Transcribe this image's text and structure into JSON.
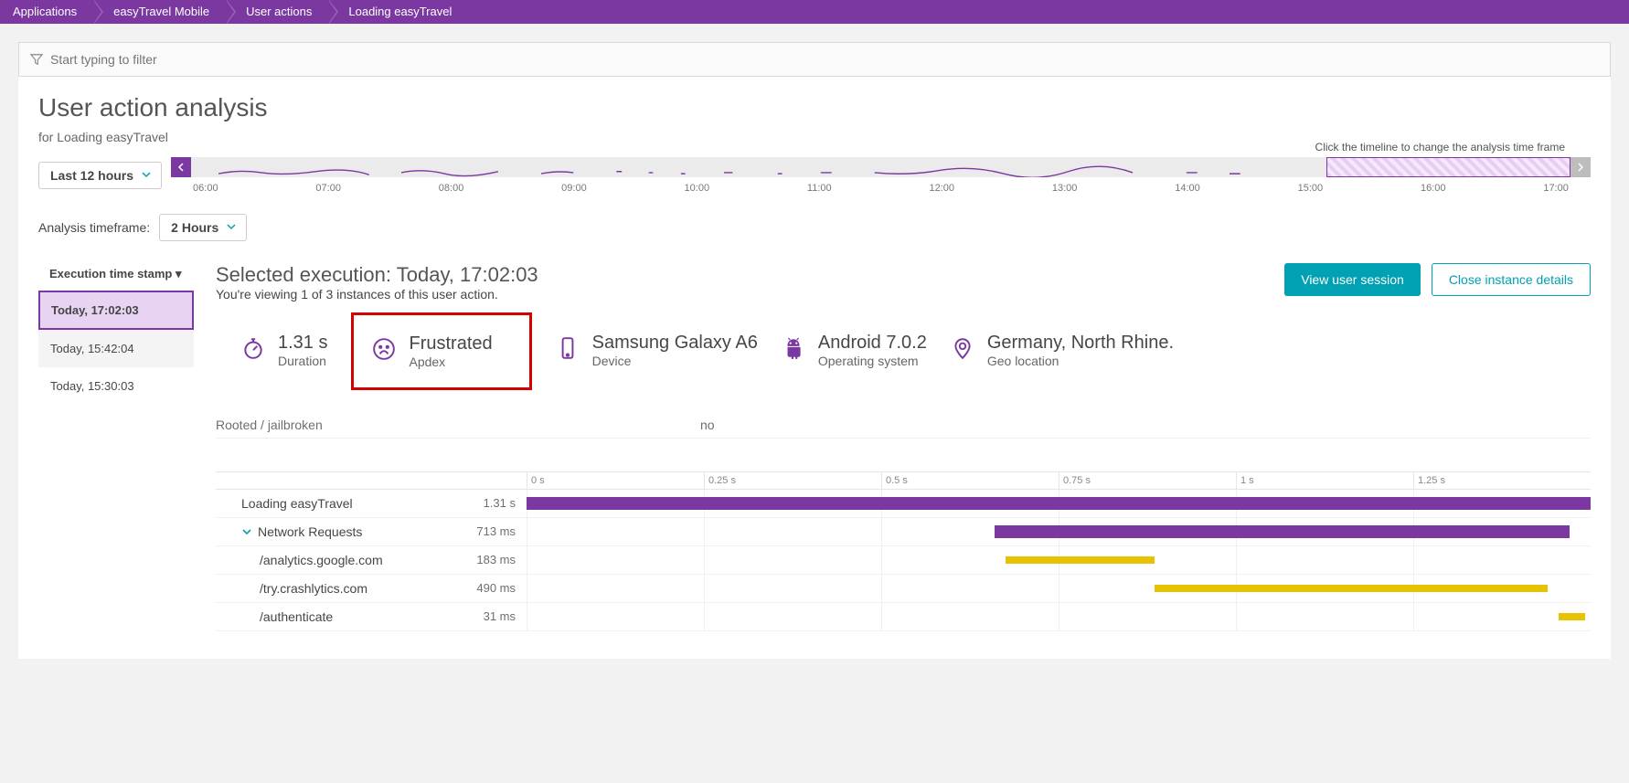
{
  "breadcrumbs": [
    "Applications",
    "easyTravel Mobile",
    "User actions",
    "Loading easyTravel"
  ],
  "filter": {
    "placeholder": "Start typing to filter"
  },
  "page": {
    "title": "User action analysis",
    "subtitle": "for Loading easyTravel",
    "time_range": "Last 12 hours",
    "timeline_hint": "Click the timeline to change the analysis time frame",
    "ticks": [
      "06:00",
      "07:00",
      "08:00",
      "09:00",
      "10:00",
      "11:00",
      "12:00",
      "13:00",
      "14:00",
      "15:00",
      "16:00",
      "17:00"
    ],
    "analysis_label": "Analysis timeframe:",
    "analysis_value": "2 Hours"
  },
  "timestamps": {
    "header": "Execution time stamp ▾",
    "items": [
      "Today, 17:02:03",
      "Today, 15:42:04",
      "Today, 15:30:03"
    ]
  },
  "detail": {
    "selected_label": "Selected execution: Today, 17:02:03",
    "viewing": "You're viewing 1 of 3 instances of this user action.",
    "btn_session": "View user session",
    "btn_close": "Close instance details"
  },
  "stats": {
    "duration": {
      "value": "1.31 s",
      "label": "Duration"
    },
    "apdex": {
      "value": "Frustrated",
      "label": "Apdex"
    },
    "device": {
      "value": "Samsung Galaxy A6",
      "label": "Device"
    },
    "os": {
      "value": "Android 7.0.2",
      "label": "Operating system"
    },
    "geo": {
      "value": "Germany, North Rhine.",
      "label": "Geo location"
    }
  },
  "rooted": {
    "label": "Rooted / jailbroken",
    "value": "no"
  },
  "waterfall": {
    "scale": [
      "0 s",
      "0.25 s",
      "0.5 s",
      "0.75 s",
      "1 s",
      "1.25 s"
    ],
    "rows": [
      {
        "name": "Loading easyTravel",
        "dur": "1.31 s",
        "start": 0,
        "len": 100,
        "color": "purple",
        "thin": false,
        "indent": 0
      },
      {
        "name": "Network Requests",
        "dur": "713 ms",
        "start": 44,
        "len": 54,
        "color": "purple",
        "thin": false,
        "indent": 1,
        "expandable": true
      },
      {
        "name": "/analytics.google.com",
        "dur": "183 ms",
        "start": 45,
        "len": 14,
        "color": "yellow",
        "thin": true,
        "indent": 2
      },
      {
        "name": "/try.crashlytics.com",
        "dur": "490 ms",
        "start": 59,
        "len": 37,
        "color": "yellow",
        "thin": true,
        "indent": 2
      },
      {
        "name": "/authenticate",
        "dur": "31 ms",
        "start": 97,
        "len": 2.5,
        "color": "yellow",
        "thin": true,
        "indent": 2
      }
    ]
  }
}
